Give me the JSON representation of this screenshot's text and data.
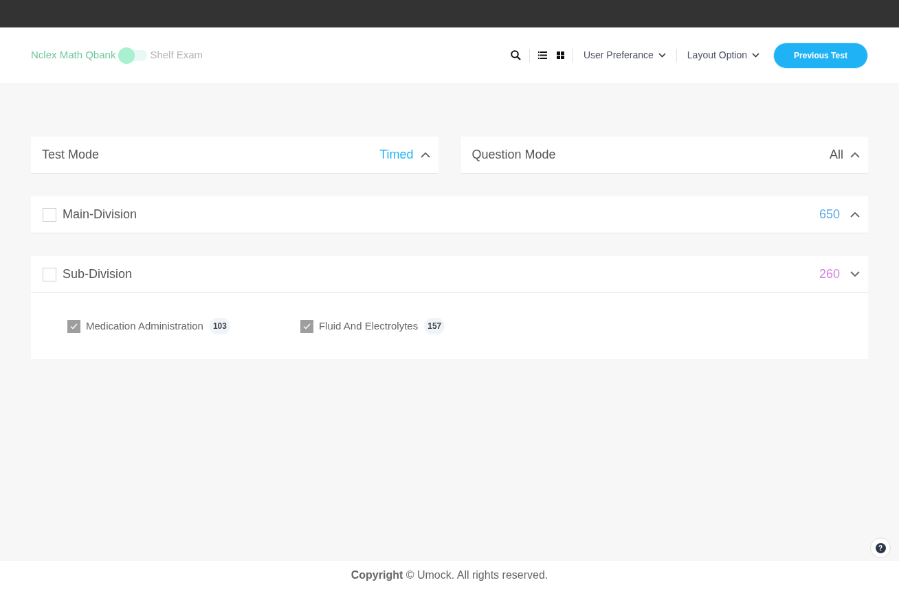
{
  "header": {
    "toggle": {
      "left_label": "Nclex Math Qbank",
      "right_label": "Shelf Exam",
      "on": false
    },
    "menus": [
      {
        "label": "User Preferance"
      },
      {
        "label": "Layout Option"
      }
    ],
    "button": "Previous Test"
  },
  "modes": [
    {
      "label": "Test Mode",
      "value": "Timed",
      "expanded": true,
      "color": "#1fb2f5"
    },
    {
      "label": "Question Mode",
      "value": "All",
      "expanded": true,
      "color": "#555555"
    }
  ],
  "divisions": [
    {
      "label": "Main-Division",
      "count": "650",
      "color": "#5aa5e6",
      "checked": false,
      "expanded": true
    },
    {
      "label": "Sub-Division",
      "count": "260",
      "color": "#d17fe0",
      "checked": false,
      "expanded": false,
      "items": [
        {
          "label": "Medication Administration",
          "count": "103",
          "checked": true
        },
        {
          "label": "Fluid And Electrolytes",
          "count": "157",
          "checked": true
        }
      ]
    }
  ],
  "help": "?",
  "footer": "**Copyright** © Umock. All rights reserved."
}
